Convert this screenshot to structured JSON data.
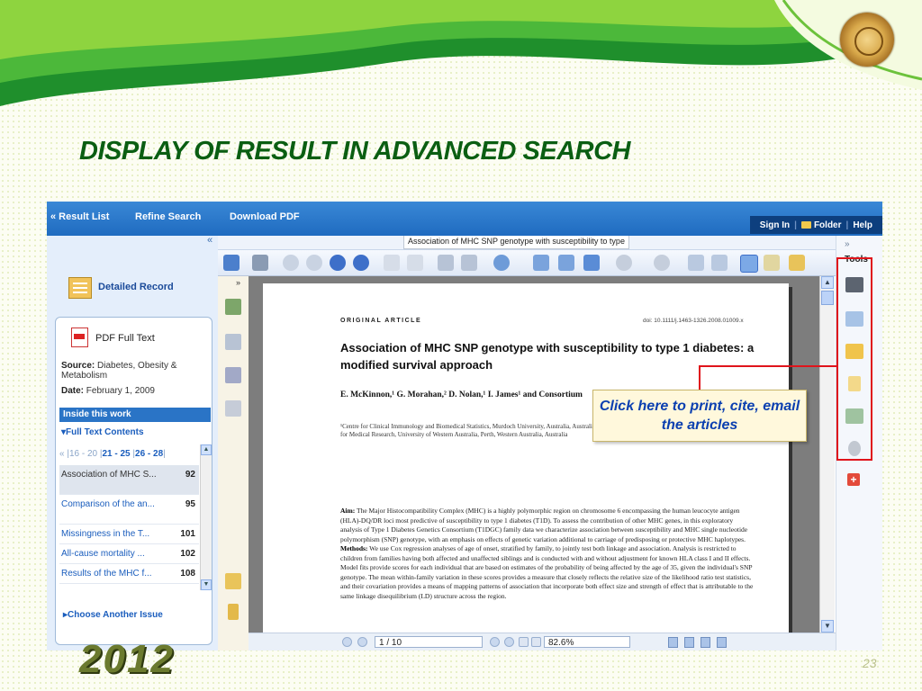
{
  "slide": {
    "title": "DISPLAY OF RESULT IN ADVANCED SEARCH",
    "year": "2012",
    "page_number": "23"
  },
  "topnav": {
    "result_list": "« Result List",
    "refine_search": "Refine Search",
    "download_pdf": "Download PDF",
    "sign_in": "Sign In",
    "folder": "Folder",
    "help": "Help"
  },
  "left": {
    "collapse": "«",
    "detailed_record": "Detailed Record",
    "pdf_full_text": "PDF Full Text",
    "source_label": "Source:",
    "source_value": "Diabetes, Obesity & Metabolism",
    "date_label": "Date:",
    "date_value": "February 1, 2009",
    "inside_this_work": "Inside this work",
    "full_text_contents": "▾Full Text Contents",
    "pager": {
      "prev": "«",
      "p1": "16 - 20",
      "p2": "21 - 25",
      "p3": "26 - 28"
    },
    "issues": [
      {
        "title": "Association of MHC S...",
        "page": "92"
      },
      {
        "title": "Comparison of the an...",
        "page": "95"
      },
      {
        "title": "Missingness in the T...",
        "page": "101"
      },
      {
        "title": "All-cause mortality ...",
        "page": "102"
      },
      {
        "title": "Results of the MHC f...",
        "page": "108"
      }
    ],
    "choose_another_issue": "▸Choose Another Issue"
  },
  "viewer": {
    "document_tab": "Association of MHC SNP genotype with susceptibility to type",
    "expand": "»",
    "page_field": "1 / 10",
    "zoom_field": "82.6%"
  },
  "article": {
    "kicker": "ORIGINAL ARTICLE",
    "doi": "doi: 10.1111/j.1463-1326.2008.01009.x",
    "title": "Association of MHC SNP genotype with susceptibility to type 1 diabetes: a modified survival approach",
    "authors": "E. McKinnon,¹ G. Morahan,² D. Nolan,¹ I. James¹ and Consortium",
    "affiliations": "¹Centre for Clinical Immunology and Biomedical Statistics, Murdoch University, Australia, Australia ²Western Australian Institute for Medical Research and Centre for Medical Research, University of Western Australia, Perth, Western Australia, Australia",
    "aim_label": "Aim:",
    "aim_text": "The Major Histocompatibility Complex (MHC) is a highly polymorphic region on chromosome 6 encompassing the human leucocyte antigen (HLA)-DQ/DR loci most predictive of susceptibility to type 1 diabetes (T1D). To assess the contribution of other MHC genes, in this exploratory analysis of Type 1 Diabetes Genetics Consortium (T1DGC) family data we characterize association between susceptibility and MHC single nucleotide polymorphism (SNP) genotype, with an emphasis on effects of genetic variation additional to carriage of predisposing or protective MHC haplotypes.",
    "methods_label": "Methods:",
    "methods_text": "We use Cox regression analyses of age of onset, stratified by family, to jointly test both linkage and association. Analysis is restricted to children from families having both affected and unaffected siblings and is conducted with and without adjustment for known HLA class I and II effects. Model fits provide scores for each individual that are based on estimates of the probability of being affected by the age of 35, given the individual's SNP genotype. The mean within-family variation in these scores provides a measure that closely reflects the relative size of the likelihood ratio test statistics, and their covariation provides a means of mapping patterns of association that incorporate both effect size and strength of effect that is attributable to the same linkage disequilibrium (LD) structure across the region."
  },
  "tools": {
    "expand": "»",
    "label": "Tools"
  },
  "callout": {
    "text": "Click here to print, cite, email the articles"
  },
  "colors": {
    "accent_blue": "#1f6bc0",
    "title_green": "#0a5e12",
    "highlight_red": "#e0141b",
    "callout_text": "#0a3fb0"
  }
}
